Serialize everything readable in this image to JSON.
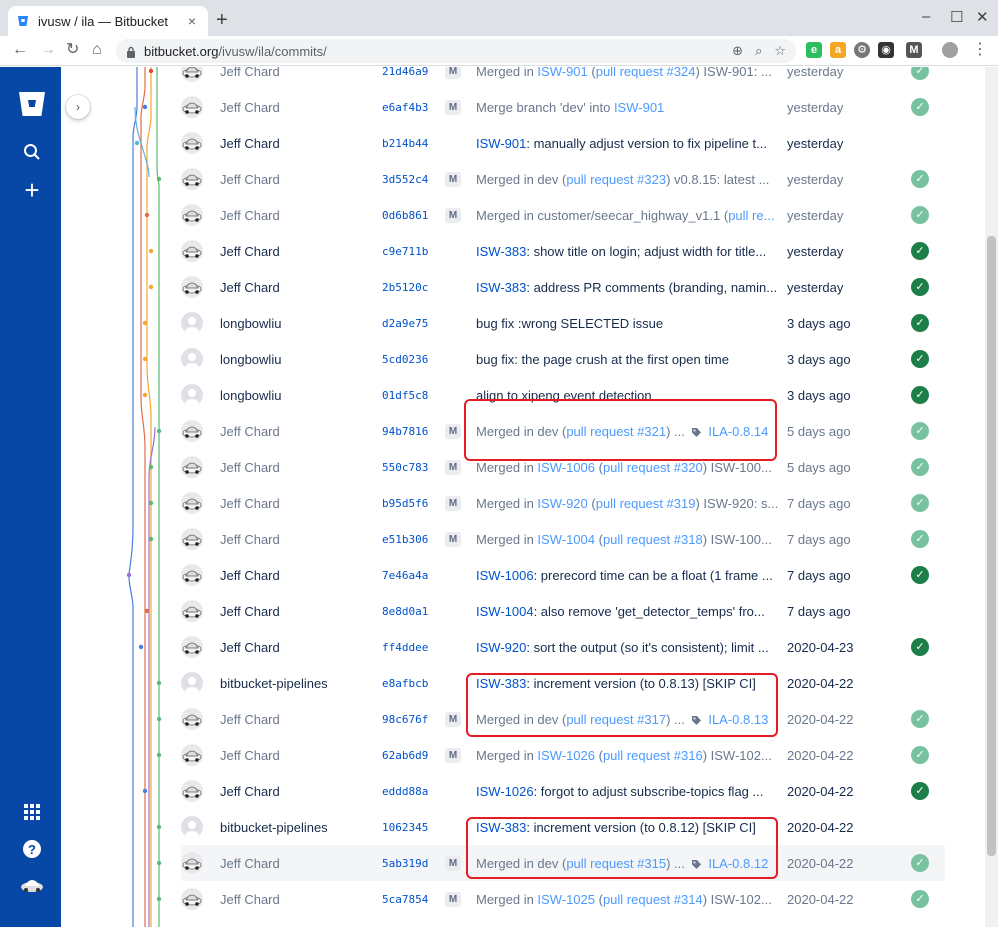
{
  "browser": {
    "tab_title": "ivusw / ila — Bitbucket",
    "url_host": "bitbucket.org",
    "url_path": "/ivusw/ila/commits/",
    "new_tab": "+",
    "close_tab": "×"
  },
  "commits": [
    {
      "author": "Jeff Chard",
      "hash": "21d46a9",
      "merge": true,
      "msg_prefix": "Merged in ",
      "link": "ISW-901",
      "msg_mid": " (",
      "link2": "pull request #324",
      "msg_suffix": ") ISW-901: ...",
      "tag": "",
      "date": "yesterday",
      "build": "light",
      "avatar": "car"
    },
    {
      "author": "Jeff Chard",
      "hash": "e6af4b3",
      "merge": true,
      "msg_prefix": "Merge branch 'dev' into ",
      "link": "ISW-901",
      "msg_mid": "",
      "link2": "",
      "msg_suffix": "",
      "tag": "",
      "date": "yesterday",
      "build": "light",
      "avatar": "car"
    },
    {
      "author": "Jeff Chard",
      "hash": "b214b44",
      "merge": false,
      "msg_prefix": "",
      "link": "ISW-901",
      "msg_mid": ": manually adjust version to fix pipeline t...",
      "link2": "",
      "msg_suffix": "",
      "tag": "",
      "date": "yesterday",
      "build": "",
      "avatar": "car"
    },
    {
      "author": "Jeff Chard",
      "hash": "3d552c4",
      "merge": true,
      "msg_prefix": "Merged in dev (",
      "link": "",
      "msg_mid": "",
      "link2": "pull request #323",
      "msg_suffix": ") v0.8.15: latest ...",
      "tag": "",
      "date": "yesterday",
      "build": "light",
      "avatar": "car"
    },
    {
      "author": "Jeff Chard",
      "hash": "0d6b861",
      "merge": true,
      "msg_prefix": "Merged in customer/seecar_highway_v1.1 (",
      "link": "",
      "msg_mid": "",
      "link2": "pull re...",
      "msg_suffix": "",
      "tag": "",
      "date": "yesterday",
      "build": "light",
      "avatar": "car"
    },
    {
      "author": "Jeff Chard",
      "hash": "c9e711b",
      "merge": false,
      "msg_prefix": "",
      "link": "ISW-383",
      "msg_mid": ": show title on login; adjust width for title...",
      "link2": "",
      "msg_suffix": "",
      "tag": "",
      "date": "yesterday",
      "build": "dark",
      "avatar": "car"
    },
    {
      "author": "Jeff Chard",
      "hash": "2b5120c",
      "merge": false,
      "msg_prefix": "",
      "link": "ISW-383",
      "msg_mid": ": address PR comments (branding, namin...",
      "link2": "",
      "msg_suffix": "",
      "tag": "",
      "date": "yesterday",
      "build": "dark",
      "avatar": "car"
    },
    {
      "author": "longbowliu",
      "hash": "d2a9e75",
      "merge": false,
      "msg_prefix": "bug fix :wrong SELECTED issue",
      "link": "",
      "msg_mid": "",
      "link2": "",
      "msg_suffix": "",
      "tag": "",
      "date": "3 days ago",
      "build": "dark",
      "avatar": "gen"
    },
    {
      "author": "longbowliu",
      "hash": "5cd0236",
      "merge": false,
      "msg_prefix": "bug fix: the page crush at the first open time",
      "link": "",
      "msg_mid": "",
      "link2": "",
      "msg_suffix": "",
      "tag": "",
      "date": "3 days ago",
      "build": "dark",
      "avatar": "gen"
    },
    {
      "author": "longbowliu",
      "hash": "01df5c8",
      "merge": false,
      "msg_prefix": "align to xipeng event detection",
      "link": "",
      "msg_mid": "",
      "link2": "",
      "msg_suffix": "",
      "tag": "",
      "date": "3 days ago",
      "build": "dark",
      "avatar": "gen"
    },
    {
      "author": "Jeff Chard",
      "hash": "94b7816",
      "merge": true,
      "msg_prefix": "Merged in dev (",
      "link": "",
      "msg_mid": "",
      "link2": "pull request #321",
      "msg_suffix": ") ...",
      "tag": "ILA-0.8.14",
      "date": "5 days ago",
      "build": "light",
      "avatar": "car"
    },
    {
      "author": "Jeff Chard",
      "hash": "550c783",
      "merge": true,
      "msg_prefix": "Merged in ",
      "link": "ISW-1006",
      "msg_mid": " (",
      "link2": "pull request #320",
      "msg_suffix": ") ISW-100...",
      "tag": "",
      "date": "5 days ago",
      "build": "light",
      "avatar": "car"
    },
    {
      "author": "Jeff Chard",
      "hash": "b95d5f6",
      "merge": true,
      "msg_prefix": "Merged in ",
      "link": "ISW-920",
      "msg_mid": " (",
      "link2": "pull request #319",
      "msg_suffix": ") ISW-920: s...",
      "tag": "",
      "date": "7 days ago",
      "build": "light",
      "avatar": "car"
    },
    {
      "author": "Jeff Chard",
      "hash": "e51b306",
      "merge": true,
      "msg_prefix": "Merged in ",
      "link": "ISW-1004",
      "msg_mid": " (",
      "link2": "pull request #318",
      "msg_suffix": ") ISW-100...",
      "tag": "",
      "date": "7 days ago",
      "build": "light",
      "avatar": "car"
    },
    {
      "author": "Jeff Chard",
      "hash": "7e46a4a",
      "merge": false,
      "msg_prefix": "",
      "link": "ISW-1006",
      "msg_mid": ": prerecord time can be a float (1 frame ...",
      "link2": "",
      "msg_suffix": "",
      "tag": "",
      "date": "7 days ago",
      "build": "dark",
      "avatar": "car"
    },
    {
      "author": "Jeff Chard",
      "hash": "8e8d0a1",
      "merge": false,
      "msg_prefix": "",
      "link": "ISW-1004",
      "msg_mid": ": also remove 'get_detector_temps' fro...",
      "link2": "",
      "msg_suffix": "",
      "tag": "",
      "date": "7 days ago",
      "build": "",
      "avatar": "car"
    },
    {
      "author": "Jeff Chard",
      "hash": "ff4ddee",
      "merge": false,
      "msg_prefix": "",
      "link": "ISW-920",
      "msg_mid": ": sort the output (so it's consistent); limit ...",
      "link2": "",
      "msg_suffix": "",
      "tag": "",
      "date": "2020-04-23",
      "build": "dark",
      "avatar": "car"
    },
    {
      "author": "bitbucket-pipelines",
      "hash": "e8afbcb",
      "merge": false,
      "msg_prefix": "",
      "link": "ISW-383",
      "msg_mid": ": increment version (to 0.8.13) [SKIP CI]",
      "link2": "",
      "msg_suffix": "",
      "tag": "",
      "date": "2020-04-22",
      "build": "",
      "avatar": "gen"
    },
    {
      "author": "Jeff Chard",
      "hash": "98c676f",
      "merge": true,
      "msg_prefix": "Merged in dev (",
      "link": "",
      "msg_mid": "",
      "link2": "pull request #317",
      "msg_suffix": ") ...",
      "tag": "ILA-0.8.13",
      "date": "2020-04-22",
      "build": "light",
      "avatar": "car"
    },
    {
      "author": "Jeff Chard",
      "hash": "62ab6d9",
      "merge": true,
      "msg_prefix": "Merged in ",
      "link": "ISW-1026",
      "msg_mid": " (",
      "link2": "pull request #316",
      "msg_suffix": ") ISW-102...",
      "tag": "",
      "date": "2020-04-22",
      "build": "light",
      "avatar": "car"
    },
    {
      "author": "Jeff Chard",
      "hash": "eddd88a",
      "merge": false,
      "msg_prefix": "",
      "link": "ISW-1026",
      "msg_mid": ": forgot to adjust subscribe-topics flag ...",
      "link2": "",
      "msg_suffix": "",
      "tag": "",
      "date": "2020-04-22",
      "build": "dark",
      "avatar": "car"
    },
    {
      "author": "bitbucket-pipelines",
      "hash": "1062345",
      "merge": false,
      "msg_prefix": "",
      "link": "ISW-383",
      "msg_mid": ": increment version (to 0.8.12) [SKIP CI]",
      "link2": "",
      "msg_suffix": "",
      "tag": "",
      "date": "2020-04-22",
      "build": "",
      "avatar": "gen"
    },
    {
      "author": "Jeff Chard",
      "hash": "5ab319d",
      "merge": true,
      "msg_prefix": "Merged in dev (",
      "link": "",
      "msg_mid": "",
      "link2": "pull request #315",
      "msg_suffix": ") ...",
      "tag": "ILA-0.8.12",
      "date": "2020-04-22",
      "build": "light",
      "avatar": "car"
    },
    {
      "author": "Jeff Chard",
      "hash": "5ca7854",
      "merge": true,
      "msg_prefix": "Merged in ",
      "link": "ISW-1025",
      "msg_mid": " (",
      "link2": "pull request #314",
      "msg_suffix": ") ISW-102...",
      "tag": "",
      "date": "2020-04-22",
      "build": "light",
      "avatar": "car"
    }
  ],
  "merge_badge": "M",
  "build_icon": "check-circle-icon",
  "colors": {
    "nav": "#0747a6",
    "link": "#0052cc",
    "success": "#36b37e",
    "highlight_box": "#e51c23"
  }
}
